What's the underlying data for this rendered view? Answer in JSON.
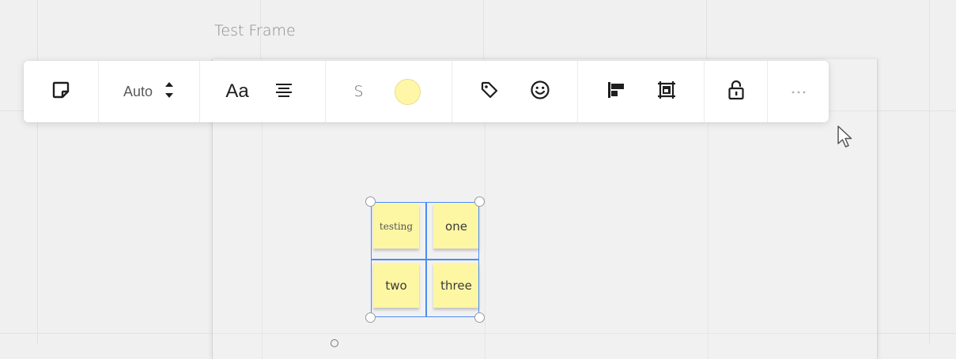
{
  "frame": {
    "title": "Test Frame"
  },
  "toolbar": {
    "sticky_icon": "sticky-note-icon",
    "size": {
      "label": "Auto",
      "icon": "up-down-chevron-icon"
    },
    "text": {
      "font_label": "Aa",
      "align_icon": "align-center-icon"
    },
    "shape": {
      "label": "S",
      "color": "#fff6a8"
    },
    "tag_icon": "tag-icon",
    "emoji_icon": "smiley-icon",
    "align_icon": "align-top-left-icon",
    "frame_icon": "frame-fit-icon",
    "lock_icon": "lock-icon",
    "more": "···"
  },
  "notes": [
    {
      "text": "testing",
      "color": "#fdf6a3"
    },
    {
      "text": "one",
      "color": "#fdf6a3"
    },
    {
      "text": "two",
      "color": "#fdf6a3"
    },
    {
      "text": "three",
      "color": "#fdf6a3"
    }
  ],
  "colors": {
    "selection": "#4a8cf0",
    "canvas": "#f0f0f0"
  }
}
